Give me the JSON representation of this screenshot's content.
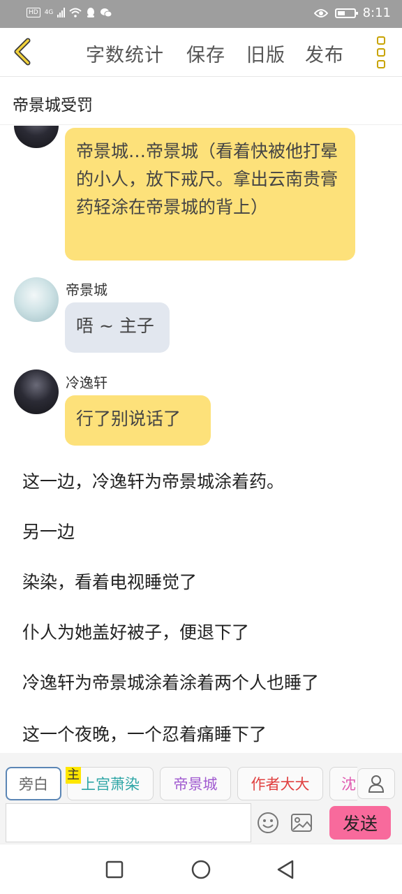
{
  "status_bar": {
    "hd_label": "HD",
    "network_label": "4G",
    "time": "8:11"
  },
  "toolbar": {
    "back_icon": "chevron-left-icon",
    "word_count": "字数统计",
    "save": "保存",
    "old_version": "旧版",
    "publish": "发布",
    "menu_icon": "more-vertical-icon",
    "accent_color": "#c8a300"
  },
  "story": {
    "title": "帝景城受罚"
  },
  "messages": [
    {
      "type": "bubble",
      "color": "yellow",
      "text": "帝景城…帝景城（看着快被他打晕的小人，放下戒尺。拿出云南贵膏药轻涂在帝景城的背上）"
    },
    {
      "type": "message",
      "sender": "帝景城",
      "color": "gray",
      "text": "唔 ~ 主子"
    },
    {
      "type": "message",
      "sender": "冷逸轩",
      "color": "yellow",
      "text": "行了别说话了"
    }
  ],
  "narration": [
    "这一边，冷逸轩为帝景城涂着药。",
    "另一边",
    "染染，看着电视睡觉了",
    "仆人为她盖好被子，便退下了",
    "冷逸轩为帝景城涂着涂着两个人也睡了",
    "这一个夜晚，一个忍着痛睡下了"
  ],
  "characters": [
    {
      "label": "旁白",
      "color": "#666666"
    },
    {
      "label": "上宫萧染",
      "color": "#2fa6a6"
    },
    {
      "label": "帝景城",
      "color": "#a05ad0"
    },
    {
      "label": "作者大大",
      "color": "#e04040"
    },
    {
      "label": "沈",
      "color": "#e05ab0"
    }
  ],
  "main_tag": "主",
  "composer": {
    "input_value": "",
    "input_placeholder": "",
    "send_label": "发送",
    "send_color": "#f86a9c"
  }
}
